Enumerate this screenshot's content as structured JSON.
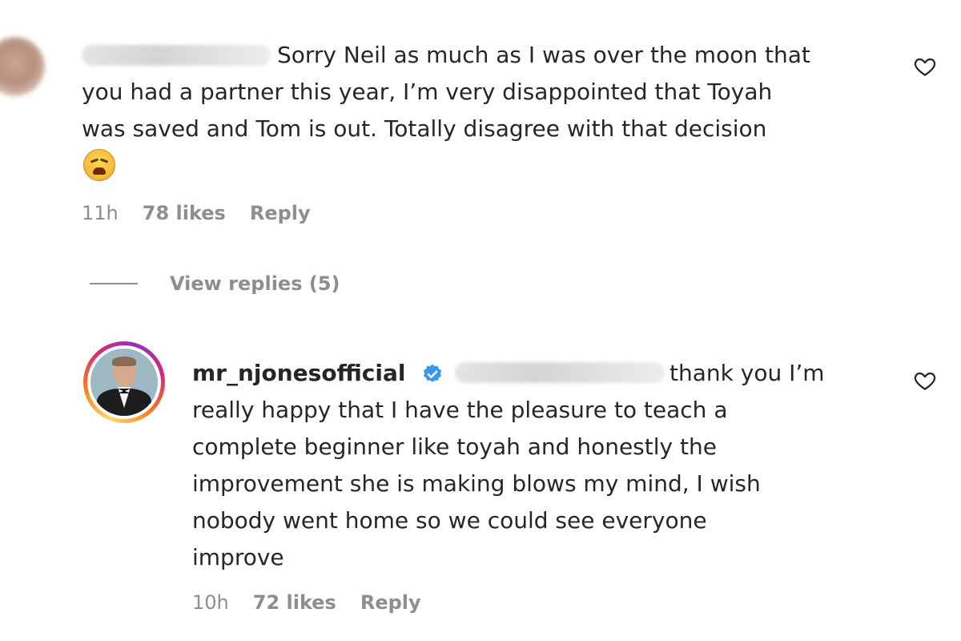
{
  "comments": [
    {
      "username_visible": false,
      "first_line": "Sorry Neil as much as I was over the moon that",
      "body_lines": "\nyou had a partner this year, I’m very disappointed that Toyah\nwas saved and Tom is out. Totally disagree with that decision",
      "emoji": "weary-face-emoji",
      "time": "11h",
      "likes": "78 likes",
      "reply": "Reply"
    },
    {
      "username": "mr_njonesofficial",
      "verified": true,
      "first_line": "thank you I’m",
      "body_lines": "\nreally happy that I have the pleasure to teach a\ncomplete beginner like toyah and honestly the\nimprovement she is making blows my mind, I wish\nnobody went home so we could see everyone\nimprove",
      "time": "10h",
      "likes": "72 likes",
      "reply": "Reply"
    }
  ],
  "view_replies": "View replies (5)",
  "colors": {
    "text": "#262626",
    "secondary": "#8e8e8e",
    "verified_blue": "#3897f0"
  },
  "icons": {
    "like": "heart-outline-icon",
    "verified": "verified-badge-icon"
  }
}
